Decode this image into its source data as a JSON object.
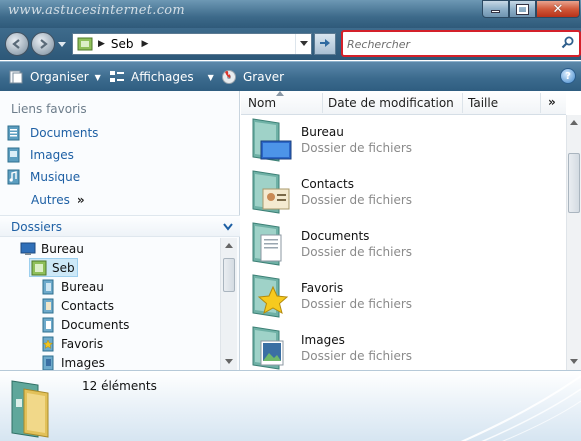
{
  "window": {
    "watermark": "www.astucesinternet.com",
    "caption_buttons": {
      "minimize": "minimize-icon",
      "maximize": "maximize-icon",
      "close": "✕"
    }
  },
  "navigation": {
    "back_icon": "back-arrow-icon",
    "forward_icon": "forward-arrow-icon",
    "address": {
      "current_folder": "Seb"
    },
    "refresh_icon": "refresh-icon",
    "search": {
      "placeholder": "Rechercher",
      "value": ""
    }
  },
  "toolbar": {
    "organize_label": "Organiser",
    "views_label": "Affichages",
    "burn_label": "Graver",
    "help_label": "?"
  },
  "favorites": {
    "title": "Liens favoris",
    "items": [
      {
        "label": "Documents",
        "icon": "documents-icon"
      },
      {
        "label": "Images",
        "icon": "images-icon"
      },
      {
        "label": "Musique",
        "icon": "music-icon"
      }
    ],
    "more_label": "Autres",
    "more_chevron": "»"
  },
  "folders": {
    "title": "Dossiers",
    "tree": [
      {
        "label": "Bureau",
        "level": 0,
        "icon": "desktop-icon"
      },
      {
        "label": "Seb",
        "level": 1,
        "icon": "user-folder-icon",
        "selected": true
      },
      {
        "label": "Bureau",
        "level": 2,
        "icon": "folder-icon"
      },
      {
        "label": "Contacts",
        "level": 2,
        "icon": "contacts-folder-icon"
      },
      {
        "label": "Documents",
        "level": 2,
        "icon": "documents-folder-icon"
      },
      {
        "label": "Favoris",
        "level": 2,
        "icon": "favorites-folder-icon"
      },
      {
        "label": "Images",
        "level": 2,
        "icon": "images-folder-icon"
      }
    ]
  },
  "columns": {
    "name": "Nom",
    "modified": "Date de modification",
    "size": "Taille",
    "more": "»"
  },
  "files": [
    {
      "name": "Bureau",
      "type": "Dossier de fichiers",
      "icon": "desktop-folder-icon"
    },
    {
      "name": "Contacts",
      "type": "Dossier de fichiers",
      "icon": "contacts-folder-icon"
    },
    {
      "name": "Documents",
      "type": "Dossier de fichiers",
      "icon": "documents-folder-icon"
    },
    {
      "name": "Favoris",
      "type": "Dossier de fichiers",
      "icon": "favorites-folder-icon"
    },
    {
      "name": "Images",
      "type": "Dossier de fichiers",
      "icon": "images-folder-icon"
    }
  ],
  "details": {
    "item_count": "12 éléments"
  },
  "colors": {
    "search_border": "#d4202a",
    "link_blue": "#1d5fa4",
    "selection": "#cde8f7"
  }
}
